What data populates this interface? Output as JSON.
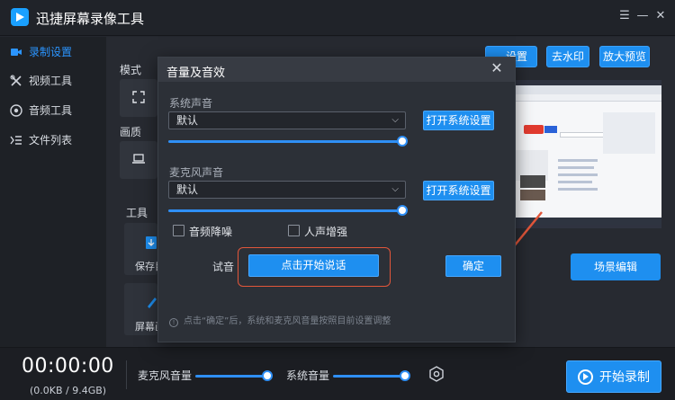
{
  "app": {
    "title": "迅捷屏幕录像工具"
  },
  "window_controls": {
    "menu": "☰",
    "minimize": "—",
    "close": "✕"
  },
  "sidebar": {
    "items": [
      {
        "label": "录制设置",
        "icon": "video-camera-icon",
        "active": true
      },
      {
        "label": "视频工具",
        "icon": "tools-icon",
        "active": false
      },
      {
        "label": "音频工具",
        "icon": "audio-icon",
        "active": false
      },
      {
        "label": "文件列表",
        "icon": "list-icon",
        "active": false
      }
    ]
  },
  "main": {
    "mode_label": "模式",
    "quality_label": "画质",
    "tools_label": "工具",
    "top_buttons": {
      "settings": "设置",
      "remove_watermark": "去水印",
      "zoom_preview": "放大预览"
    },
    "scene_edit": "场景编辑",
    "tool_cards": [
      {
        "label": "保存目"
      },
      {
        "label": "屏幕画"
      }
    ]
  },
  "dialog": {
    "title": "音量及音效",
    "system_sound_label": "系统声音",
    "system_sound_value": "默认",
    "system_open_btn": "打开系统设置",
    "mic_sound_label": "麦克风声音",
    "mic_sound_value": "默认",
    "mic_open_btn": "打开系统设置",
    "noise_reduction_label": "音频降噪",
    "voice_enhance_label": "人声增强",
    "test_label": "试音",
    "start_speaking_btn": "点击开始说话",
    "confirm_btn": "确定",
    "note": "点击“确定”后，系统和麦克风音量按照目前设置调整",
    "system_volume": 1.0,
    "mic_volume": 1.0
  },
  "bottom": {
    "timer": "00:00:00",
    "storage": "(0.0KB / 9.4GB)",
    "mic_volume_label": "麦克风音量",
    "system_volume_label": "系统音量",
    "record_btn": "开始录制",
    "mic_volume": 1.0,
    "system_volume": 1.0
  },
  "colors": {
    "accent": "#1e8ff0",
    "highlight_outline": "#e2563a"
  }
}
